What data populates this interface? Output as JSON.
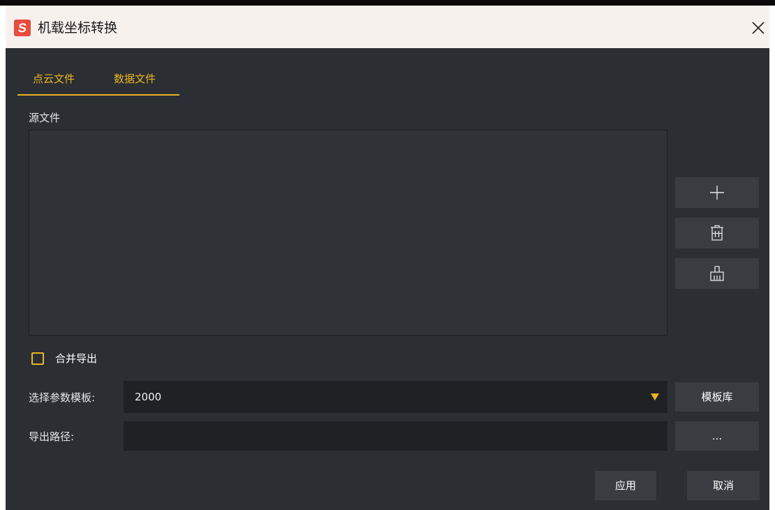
{
  "window": {
    "title": "机载坐标转换",
    "logo_letter": "S",
    "logo_color": "#e84c3d"
  },
  "tabs": [
    {
      "label": "点云文件",
      "active": true
    },
    {
      "label": "数据文件",
      "active": false
    }
  ],
  "source": {
    "label": "源文件",
    "files": [],
    "actions": [
      {
        "name": "add",
        "icon": "plus-icon"
      },
      {
        "name": "delete",
        "icon": "trash-icon"
      },
      {
        "name": "clear",
        "icon": "broom-icon"
      }
    ]
  },
  "merge_export": {
    "label": "合并导出",
    "checked": false
  },
  "template": {
    "label": "选择参数模板:",
    "value": "2000",
    "library_button": "模板库"
  },
  "export_path": {
    "label": "导出路径:",
    "value": "",
    "browse_button": "..."
  },
  "footer": {
    "apply": "应用",
    "cancel": "取消"
  },
  "colors": {
    "accent": "#e9b624",
    "background": "#2b2e33",
    "title_bar": "#f7f1ee"
  }
}
